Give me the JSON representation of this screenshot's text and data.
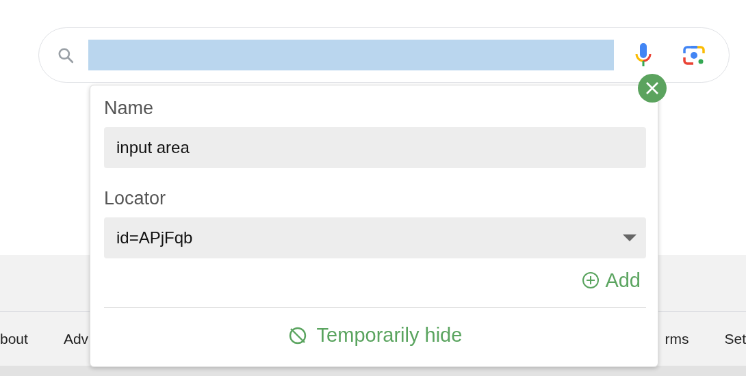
{
  "search": {
    "highlighted": true
  },
  "footer_links": [
    "bout",
    "Adv",
    "rms",
    "Set"
  ],
  "popup": {
    "fields": [
      {
        "label": "Name",
        "kind": "text",
        "value": "input area"
      },
      {
        "label": "Locator",
        "kind": "select",
        "value": "id=APjFqb"
      }
    ],
    "add_label": "Add",
    "hide_label": "Temporarily hide"
  }
}
